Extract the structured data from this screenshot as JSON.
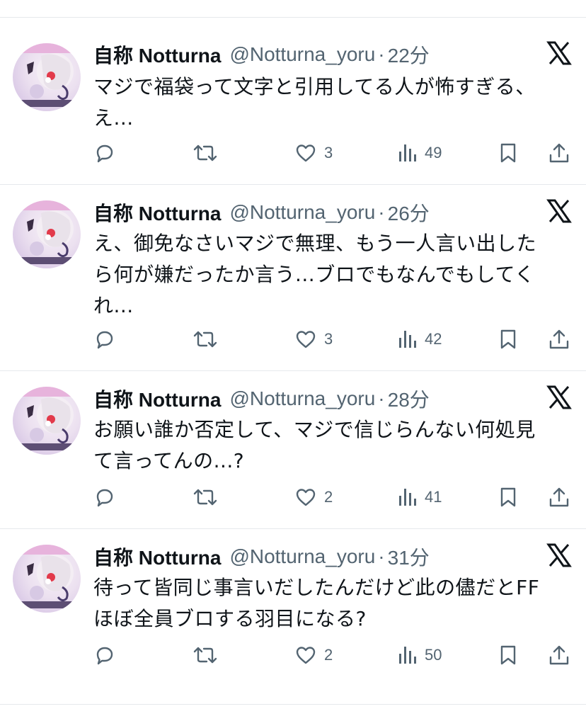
{
  "tweets": [
    {
      "name": "自称 Notturna",
      "handle": "@Notturna_yoru",
      "separator": "·",
      "time": "22分",
      "text": "マジで福袋って文字と引用してる人が怖すぎる、\nえ...",
      "likes": "3",
      "views": "49"
    },
    {
      "name": "自称 Notturna",
      "handle": "@Notturna_yoru",
      "separator": "·",
      "time": "26分",
      "text": "え、御免なさいマジで無理、もう一人言い出した\nら何が嫌だったか言う...ブロでもなんでもしてく\nれ...",
      "likes": "3",
      "views": "42"
    },
    {
      "name": "自称 Notturna",
      "handle": "@Notturna_yoru",
      "separator": "·",
      "time": "28分",
      "text": "お願い誰か否定して、マジで信じらんない何処見\nて言ってんの...?",
      "likes": "2",
      "views": "41"
    },
    {
      "name": "自称 Notturna",
      "handle": "@Notturna_yoru",
      "separator": "·",
      "time": "31分",
      "text": "待って皆同じ事言いだしたんだけど此の儘だとFF\nほぼ全員ブロする羽目になる?",
      "likes": "2",
      "views": "50"
    }
  ],
  "icons": {
    "reply": "reply-icon",
    "retweet": "retweet-icon",
    "like": "heart-icon",
    "views": "views-icon",
    "bookmark": "bookmark-icon",
    "share": "share-icon",
    "brand": "x-logo-icon"
  },
  "colors": {
    "text": "#0f1419",
    "secondary": "#536471",
    "divider": "#e6e9ec"
  }
}
